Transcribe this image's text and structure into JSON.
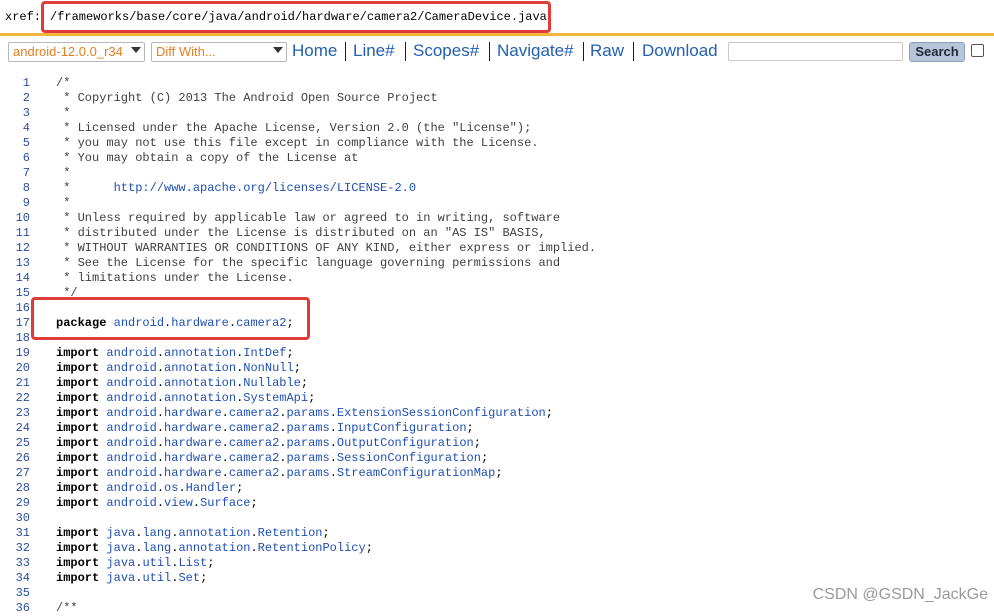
{
  "header": {
    "xref_label": "xref:",
    "path": "/frameworks/base/core/java/android/hardware/camera2/CameraDevice.java"
  },
  "toolbar": {
    "release_select": "android-12.0.0_r34",
    "diff_select": "Diff With...",
    "links": [
      "Home",
      "Line#",
      "Scopes#",
      "Navigate#",
      "Raw",
      "Download"
    ],
    "search_button": "Search",
    "search_value": ""
  },
  "code": {
    "lines": [
      {
        "n": "1",
        "t": "/*",
        "k": "comment"
      },
      {
        "n": "2",
        "t": " * Copyright (C) 2013 The Android Open Source Project",
        "k": "comment"
      },
      {
        "n": "3",
        "t": " *",
        "k": "comment"
      },
      {
        "n": "4",
        "t": " * Licensed under the Apache License, Version 2.0 (the \"License\");",
        "k": "comment"
      },
      {
        "n": "5",
        "t": " * you may not use this file except in compliance with the License.",
        "k": "comment"
      },
      {
        "n": "6",
        "t": " * You may obtain a copy of the License at",
        "k": "comment"
      },
      {
        "n": "7",
        "t": " *",
        "k": "comment"
      },
      {
        "n": "8",
        "t": " *      ",
        "k": "url",
        "u": "http://www.apache.org/licenses/LICENSE-2.0"
      },
      {
        "n": "9",
        "t": " *",
        "k": "comment"
      },
      {
        "n": "10",
        "t": " * Unless required by applicable law or agreed to in writing, software",
        "k": "comment"
      },
      {
        "n": "11",
        "t": " * distributed under the License is distributed on an \"AS IS\" BASIS,",
        "k": "comment"
      },
      {
        "n": "12",
        "t": " * WITHOUT WARRANTIES OR CONDITIONS OF ANY KIND, either express or implied.",
        "k": "comment"
      },
      {
        "n": "13",
        "t": " * See the License for the specific language governing permissions and",
        "k": "comment"
      },
      {
        "n": "14",
        "t": " * limitations under the License.",
        "k": "comment"
      },
      {
        "n": "15",
        "t": " */",
        "k": "comment"
      },
      {
        "n": "16",
        "t": "",
        "k": "blank"
      },
      {
        "n": "17",
        "kw": "package",
        "t": "android.hardware.camera2",
        "k": "pkg"
      },
      {
        "n": "18",
        "t": "",
        "k": "blank"
      },
      {
        "n": "19",
        "kw": "import",
        "t": "android.annotation.IntDef",
        "k": "import"
      },
      {
        "n": "20",
        "kw": "import",
        "t": "android.annotation.NonNull",
        "k": "import"
      },
      {
        "n": "21",
        "kw": "import",
        "t": "android.annotation.Nullable",
        "k": "import"
      },
      {
        "n": "22",
        "kw": "import",
        "t": "android.annotation.SystemApi",
        "k": "import"
      },
      {
        "n": "23",
        "kw": "import",
        "t": "android.hardware.camera2.params.ExtensionSessionConfiguration",
        "k": "import"
      },
      {
        "n": "24",
        "kw": "import",
        "t": "android.hardware.camera2.params.InputConfiguration",
        "k": "import"
      },
      {
        "n": "25",
        "kw": "import",
        "t": "android.hardware.camera2.params.OutputConfiguration",
        "k": "import"
      },
      {
        "n": "26",
        "kw": "import",
        "t": "android.hardware.camera2.params.SessionConfiguration",
        "k": "import"
      },
      {
        "n": "27",
        "kw": "import",
        "t": "android.hardware.camera2.params.StreamConfigurationMap",
        "k": "import"
      },
      {
        "n": "28",
        "kw": "import",
        "t": "android.os.Handler",
        "k": "import"
      },
      {
        "n": "29",
        "kw": "import",
        "t": "android.view.Surface",
        "k": "import"
      },
      {
        "n": "30",
        "t": "",
        "k": "blank"
      },
      {
        "n": "31",
        "kw": "import",
        "t": "java.lang.annotation.Retention",
        "k": "import"
      },
      {
        "n": "32",
        "kw": "import",
        "t": "java.lang.annotation.RetentionPolicy",
        "k": "import"
      },
      {
        "n": "33",
        "kw": "import",
        "t": "java.util.List",
        "k": "import"
      },
      {
        "n": "34",
        "kw": "import",
        "t": "java.util.Set",
        "k": "import"
      },
      {
        "n": "35",
        "t": "",
        "k": "blank"
      },
      {
        "n": "36",
        "t": "/**",
        "k": "comment"
      }
    ]
  },
  "watermark": "CSDN @GSDN_JackGe",
  "colors": {
    "accent_rule": "#f2b43b",
    "highlight_box": "#e03b3b",
    "link": "#2260b0",
    "select_text": "#e67e22"
  }
}
